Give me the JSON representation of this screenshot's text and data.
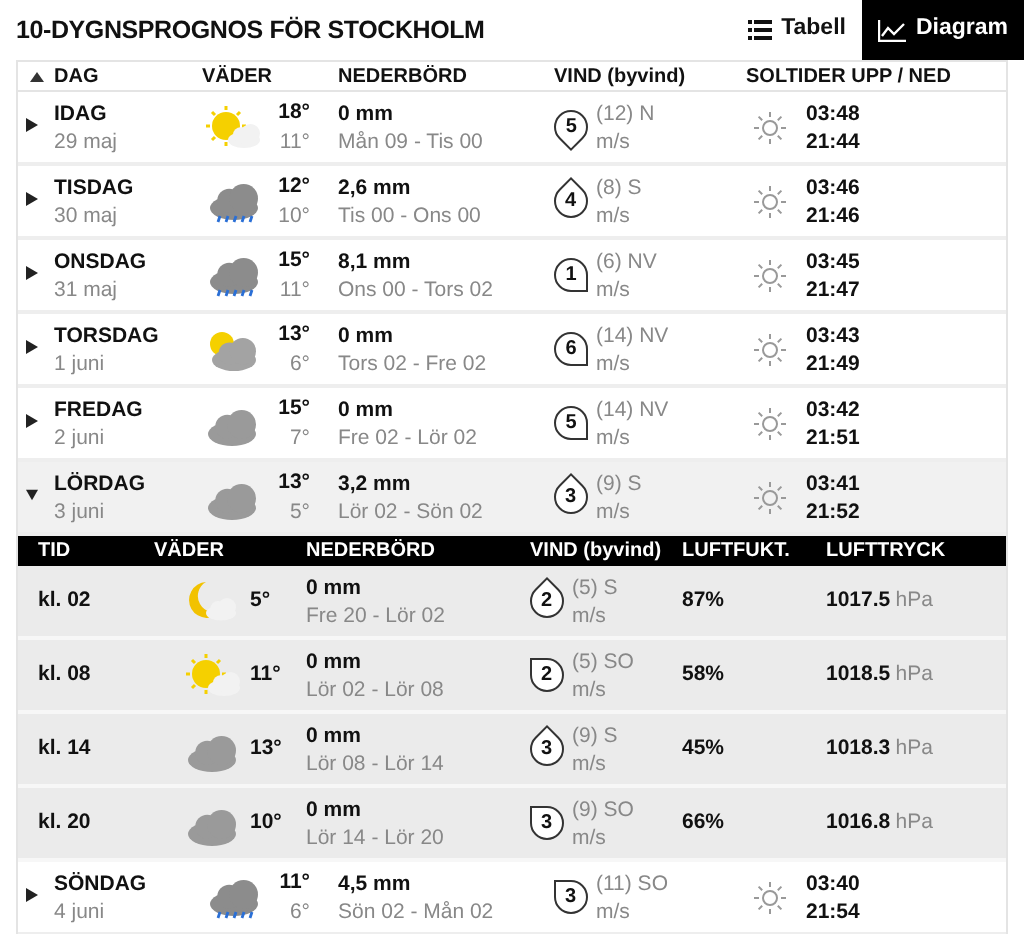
{
  "title": "10-DYGNSPROGNOS FÖR STOCKHOLM",
  "views": [
    {
      "label": "Tabell",
      "kind": "list",
      "selected": false
    },
    {
      "label": "Diagram",
      "kind": "chart",
      "selected": true
    }
  ],
  "columns": [
    "DAG",
    "VÄDER",
    "NEDERBÖRD",
    "VIND (byvind)",
    "SOLTIDER UPP / NED"
  ],
  "days": [
    {
      "day": "IDAG",
      "date": "29 maj",
      "icon": {
        "kind": "sun-cloud"
      },
      "high": "18°",
      "low": "11°",
      "precip": "0 mm",
      "period": "Mån 09 - Tis 00",
      "wind": {
        "kind": "down",
        "speed": "5"
      },
      "gust": "(12) N",
      "unit": "m/s",
      "sunrise": "03:48",
      "sunset": "21:44",
      "expanded": false
    },
    {
      "day": "TISDAG",
      "date": "30 maj",
      "icon": {
        "kind": "rain"
      },
      "high": "12°",
      "low": "10°",
      "precip": "2,6 mm",
      "period": "Tis 00 - Ons 00",
      "wind": {
        "kind": "up",
        "speed": "4"
      },
      "gust": "(8) S",
      "unit": "m/s",
      "sunrise": "03:46",
      "sunset": "21:46",
      "expanded": false
    },
    {
      "day": "ONSDAG",
      "date": "31 maj",
      "icon": {
        "kind": "rain"
      },
      "high": "15°",
      "low": "11°",
      "precip": "8,1 mm",
      "period": "Ons 00 - Tors 02",
      "wind": {
        "kind": "down-right",
        "speed": "1"
      },
      "gust": "(6) NV",
      "unit": "m/s",
      "sunrise": "03:45",
      "sunset": "21:47",
      "expanded": false
    },
    {
      "day": "TORSDAG",
      "date": "1 juni",
      "icon": {
        "kind": "partly-sunny"
      },
      "high": "13°",
      "low": "6°",
      "precip": "0 mm",
      "period": "Tors 02 - Fre 02",
      "wind": {
        "kind": "down-right",
        "speed": "6"
      },
      "gust": "(14) NV",
      "unit": "m/s",
      "sunrise": "03:43",
      "sunset": "21:49",
      "expanded": false
    },
    {
      "day": "FREDAG",
      "date": "2 juni",
      "icon": {
        "kind": "cloud"
      },
      "high": "15°",
      "low": "7°",
      "precip": "0 mm",
      "period": "Fre 02 - Lör 02",
      "wind": {
        "kind": "down-right",
        "speed": "5"
      },
      "gust": "(14) NV",
      "unit": "m/s",
      "sunrise": "03:42",
      "sunset": "21:51",
      "expanded": false
    },
    {
      "day": "LÖRDAG",
      "date": "3 juni",
      "icon": {
        "kind": "cloud"
      },
      "high": "13°",
      "low": "5°",
      "precip": "3,2 mm",
      "period": "Lör 02 - Sön 02",
      "wind": {
        "kind": "up",
        "speed": "3"
      },
      "gust": "(9) S",
      "unit": "m/s",
      "sunrise": "03:41",
      "sunset": "21:52",
      "expanded": true,
      "hour_columns": [
        "TID",
        "VÄDER",
        "NEDERBÖRD",
        "VIND (byvind)",
        "LUFTFUKT.",
        "LUFTTRYCK"
      ],
      "hours": [
        {
          "time": "kl. 02",
          "icon": {
            "kind": "moon-cloud"
          },
          "temp": "5°",
          "precip": "0 mm",
          "period": "Fre 20 - Lör 02",
          "wind": {
            "kind": "up",
            "speed": "2"
          },
          "gust": "(5) S",
          "unit": "m/s",
          "humidity": "87%",
          "pressure": "1017.5",
          "pressure_unit": "hPa"
        },
        {
          "time": "kl. 08",
          "icon": {
            "kind": "sun-cloud"
          },
          "temp": "11°",
          "precip": "0 mm",
          "period": "Lör 02 - Lör 08",
          "wind": {
            "kind": "up-left",
            "speed": "2"
          },
          "gust": "(5) SO",
          "unit": "m/s",
          "humidity": "58%",
          "pressure": "1018.5",
          "pressure_unit": "hPa"
        },
        {
          "time": "kl. 14",
          "icon": {
            "kind": "cloud"
          },
          "temp": "13°",
          "precip": "0 mm",
          "period": "Lör 08 - Lör 14",
          "wind": {
            "kind": "up",
            "speed": "3"
          },
          "gust": "(9) S",
          "unit": "m/s",
          "humidity": "45%",
          "pressure": "1018.3",
          "pressure_unit": "hPa"
        },
        {
          "time": "kl. 20",
          "icon": {
            "kind": "cloud"
          },
          "temp": "10°",
          "precip": "0 mm",
          "period": "Lör 14 - Lör 20",
          "wind": {
            "kind": "up-left",
            "speed": "3"
          },
          "gust": "(9) SO",
          "unit": "m/s",
          "humidity": "66%",
          "pressure": "1016.8",
          "pressure_unit": "hPa"
        }
      ]
    },
    {
      "day": "SÖNDAG",
      "date": "4 juni",
      "icon": {
        "kind": "rain"
      },
      "high": "11°",
      "low": "6°",
      "precip": "4,5 mm",
      "period": "Sön 02 - Mån 02",
      "wind": {
        "kind": "up-left",
        "speed": "3"
      },
      "gust": "(11) SO",
      "unit": "m/s",
      "sunrise": "03:40",
      "sunset": "21:54",
      "expanded": false
    }
  ]
}
